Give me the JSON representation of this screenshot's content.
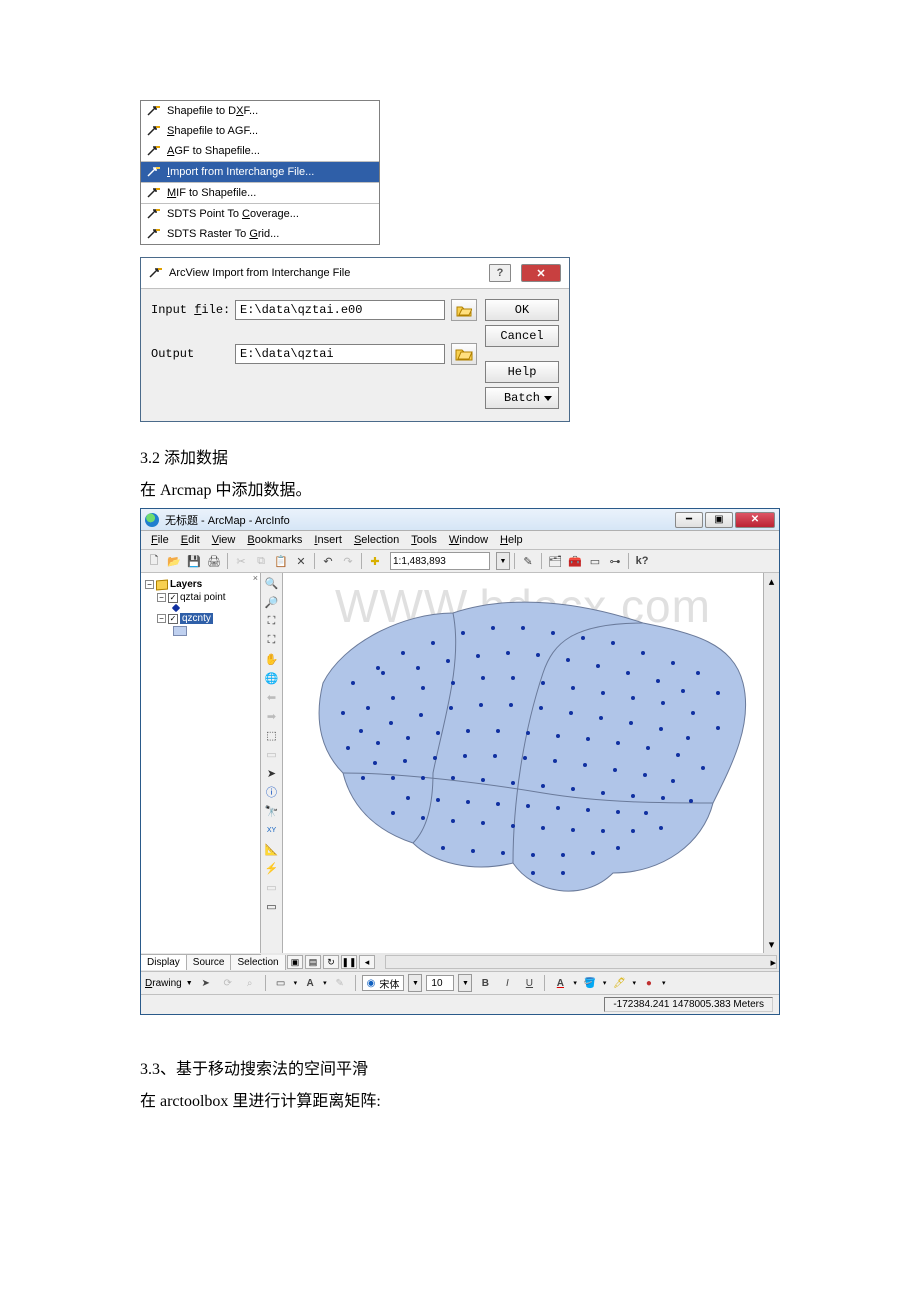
{
  "menu": {
    "items": [
      {
        "before": "Shapefile to D",
        "u": "X",
        "after": "F..."
      },
      {
        "before": "",
        "u": "S",
        "after": "hapefile to AGF..."
      },
      {
        "before": "",
        "u": "A",
        "after": "GF to Shapefile..."
      },
      {
        "before": "",
        "u": "I",
        "after": "mport from Interchange File..."
      },
      {
        "before": "",
        "u": "M",
        "after": "IF to Shapefile..."
      },
      {
        "before": "SDTS Point To ",
        "u": "C",
        "after": "overage..."
      },
      {
        "before": "SDTS Raster To ",
        "u": "G",
        "after": "rid..."
      }
    ],
    "selected_index": 3
  },
  "dialog": {
    "title": "ArcView Import from Interchange File",
    "input_label": "Input file:",
    "input_value": "E:\\data\\qztai.e00",
    "output_label": "Output",
    "output_value": "E:\\data\\qztai",
    "ok": "OK",
    "cancel": "Cancel",
    "help": "Help",
    "batch": "Batch"
  },
  "doc": {
    "sec32": "3.2 添加数据",
    "sec32_p": "在 Arcmap 中添加数据。",
    "sec33": "3.3、基于移动搜索法的空间平滑",
    "sec33_p": "在 arctoolbox 里进行计算距离矩阵:"
  },
  "arcmap": {
    "title": "无标题 - ArcMap - ArcInfo",
    "menubar": [
      "File",
      "Edit",
      "View",
      "Bookmarks",
      "Insert",
      "Selection",
      "Tools",
      "Window",
      "Help"
    ],
    "scale": "1:1,483,893",
    "toc": {
      "root": "Layers",
      "layer1": "qztai point",
      "layer2": "qzcnty",
      "tabs": [
        "Display",
        "Source",
        "Selection"
      ]
    },
    "drawing": {
      "label": "Drawing",
      "font_name": "宋体",
      "font_size": "10"
    },
    "status": "-172384.241 1478005.383 Meters",
    "watermark": "WWW.bdocx.com"
  }
}
